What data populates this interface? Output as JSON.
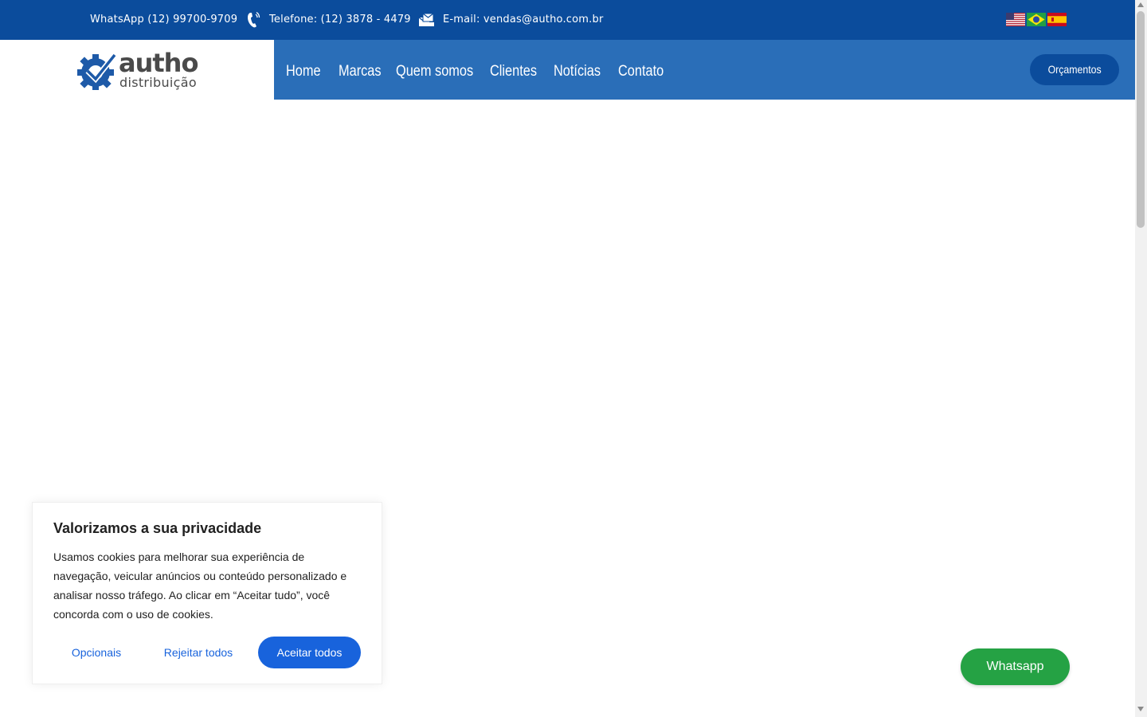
{
  "topbar": {
    "whatsapp": "WhatsApp (12) 99700-9709",
    "phone": "Telefone: (12) 3878 - 4479",
    "email": "E-mail: vendas@autho.com.br",
    "phone_icon": "phone-ringing-icon",
    "email_icon": "envelope-icon",
    "flags": [
      "flag-us",
      "flag-br",
      "flag-es"
    ],
    "bg_color": "#0b4c9c"
  },
  "logo": {
    "word": "autho",
    "sub": "distribuição",
    "icon": "gear-check-logo-icon"
  },
  "nav": {
    "items": [
      "Home",
      "Marcas",
      "Quem somos",
      "Clientes",
      "Notícias",
      "Contato"
    ],
    "cta": "Orçamentos",
    "bg_color": "#2a6eb8"
  },
  "cookie": {
    "title": "Valorizamos a sua privacidade",
    "text": "Usamos cookies para melhorar sua experiência de navegação, veicular anúncios ou conteúdo personalizado e analisar nosso tráfego. Ao clicar em “Aceitar tudo”, você concorda com o uso de cookies.",
    "options": "Opcionais",
    "reject": "Rejeitar todos",
    "accept": "Aceitar todos",
    "accent_color": "#1863dc"
  },
  "whatsapp_button": {
    "label": "Whatsapp",
    "color": "#25a244"
  }
}
